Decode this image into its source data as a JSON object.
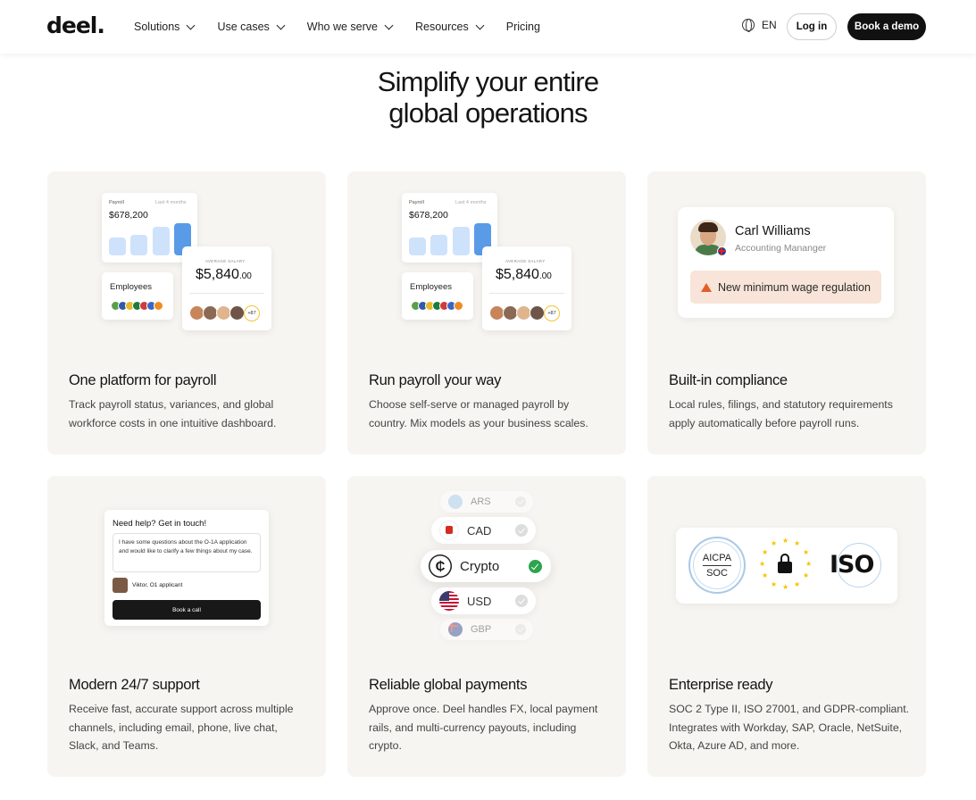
{
  "nav": {
    "logo": "deel.",
    "menu": [
      {
        "label": "Solutions"
      },
      {
        "label": "Use cases"
      },
      {
        "label": "Who we serve"
      },
      {
        "label": "Resources"
      },
      {
        "label": "Pricing"
      }
    ],
    "language": "EN",
    "login_label": "Log in",
    "demo_label": "Book a demo"
  },
  "headline": {
    "line1": "Simplify your entire",
    "line2": "global operations"
  },
  "cards": [
    {
      "title": "One platform for payroll",
      "text": "Track payroll status, variances, and global workforce costs in one intuitive dashboard.",
      "widget": {
        "payroll_label": "Payroll",
        "period_label": "Last 4 months",
        "payroll_value": "$678,200",
        "bar_levels": [
          0.55,
          0.65,
          0.9,
          1.0
        ],
        "employees_label": "Employees",
        "avg_label": "AVERAGE SALARY",
        "avg_value": "$5,840",
        "avg_cents": ".00",
        "more_count": "+87"
      }
    },
    {
      "title": "Run payroll your way",
      "text": "Choose self-serve or managed payroll by country. Mix models as your business scales.",
      "widget": {
        "payroll_label": "Payroll",
        "period_label": "Last 4 months",
        "payroll_value": "$678,200",
        "bar_levels": [
          0.55,
          0.65,
          0.9,
          1.0
        ],
        "employees_label": "Employees",
        "avg_label": "AVERAGE SALARY",
        "avg_value": "$5,840",
        "avg_cents": ".00",
        "more_count": "+87"
      }
    },
    {
      "title": "Built-in compliance",
      "text": "Local rules, filings, and statutory requirements apply automatically before payroll runs.",
      "widget": {
        "name": "Carl Williams",
        "role": "Accounting Mananger",
        "alert": "New minimum wage regulation"
      }
    },
    {
      "title": "Modern 24/7 support",
      "text": "Receive fast, accurate support across multiple channels, including email, phone, live chat, Slack, and Teams.",
      "widget": {
        "heading": "Need help? Get in touch!",
        "message": "I have some questions about the O-1A application and would like to clarify a few things about my case.",
        "user": "Viktor, O1 applicant",
        "button": "Book a call"
      }
    },
    {
      "title": "Reliable global payments",
      "text": "Approve once. Deel handles FX, local payment rails, and multi-currency payouts, including crypto.",
      "widget": {
        "currencies": [
          "ARS",
          "CAD",
          "Crypto",
          "USD",
          "GBP"
        ]
      }
    },
    {
      "title": "Enterprise ready",
      "text": "SOC 2 Type II, ISO 27001, and GDPR-compliant. Integrates with Workday, SAP, Oracle, NetSuite, Okta, Azure AD, and more.",
      "widget": {
        "aicpa_top": "AICPA",
        "aicpa_bottom": "SOC",
        "iso": "ISO"
      }
    }
  ],
  "colors": {
    "card_bg": "#f7f5f1",
    "bar_light": "#cfe2fb",
    "bar_dark": "#5a9be8",
    "alert_bg": "#f8e4d8",
    "alert_icon": "#e35d2b",
    "check_green": "#2da44e",
    "star_gold": "#f2c500"
  }
}
